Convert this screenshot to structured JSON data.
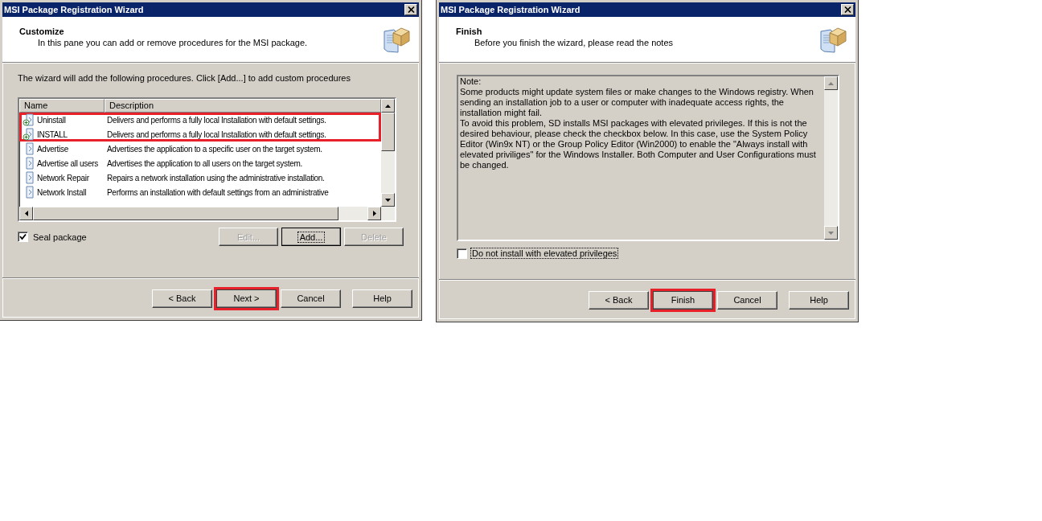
{
  "windows": [
    {
      "kind": "list",
      "title": "MSI Package Registration Wizard",
      "header": {
        "title": "Customize",
        "subtitle": "In this pane you can add or remove procedures for the MSI package."
      },
      "instruction": "The wizard will add the following procedures. Click [Add...] to add custom procedures",
      "list": {
        "columns": [
          "Name",
          "Description"
        ],
        "rows": [
          {
            "name": "Uninstall",
            "description": "Delivers and performs a fully local Installation with default settings.",
            "plus": true,
            "highlighted": true
          },
          {
            "name": "INSTALL",
            "description": "Delivers and performs a fully local Installation with default settings.",
            "plus": true,
            "highlighted": true
          },
          {
            "name": "Advertise",
            "description": "Advertises the application to a specific user on the target system.",
            "plus": false,
            "highlighted": false
          },
          {
            "name": "Advertise all users",
            "description": "Advertises the application to all users on the target system.",
            "plus": false,
            "highlighted": false
          },
          {
            "name": "Network Repair",
            "description": "Repairs a network installation using the administrative installation.",
            "plus": false,
            "highlighted": false
          },
          {
            "name": "Network Install",
            "description": "Performs an installation with default settings from an administrative",
            "plus": false,
            "highlighted": false
          }
        ]
      },
      "checkbox": {
        "label": "Seal package",
        "checked": true,
        "focused": false
      },
      "actions": [
        {
          "label": "Edit...",
          "disabled": true,
          "focused": false
        },
        {
          "label": "Add...",
          "disabled": false,
          "focused": true
        },
        {
          "label": "Delete",
          "disabled": true,
          "focused": false
        }
      ],
      "buttons": [
        {
          "label": "< Back",
          "highlighted": false
        },
        {
          "label": "Next >",
          "highlighted": true
        },
        {
          "label": "Cancel",
          "highlighted": false
        },
        {
          "label": "Help",
          "highlighted": false
        }
      ]
    },
    {
      "kind": "notes",
      "title": "MSI Package Registration Wizard",
      "header": {
        "title": "Finish",
        "subtitle": "Before you finish the wizard, please read the notes"
      },
      "notes": [
        "Note:",
        "Some products might update system files or make changes to the Windows registry. When sending an installation job to a user or computer with inadequate access rights, the installation might fail.",
        "To avoid this problem, SD installs MSI packages with elevated privileges. If this is not the desired behaviour, please check the checkbox below. In this case, use the System Policy Editor (Win9x NT) or the Group Policy Editor (Win2000) to enable the \"Always install with elevated priviliges\" for the Windows Installer. Both Computer and User Configurations must be changed."
      ],
      "checkbox": {
        "label": "Do not install with elevated privileges",
        "checked": false,
        "focused": true
      },
      "buttons": [
        {
          "label": "< Back",
          "highlighted": false
        },
        {
          "label": "Finish",
          "highlighted": true
        },
        {
          "label": "Cancel",
          "highlighted": false
        },
        {
          "label": "Help",
          "highlighted": false
        }
      ]
    }
  ]
}
